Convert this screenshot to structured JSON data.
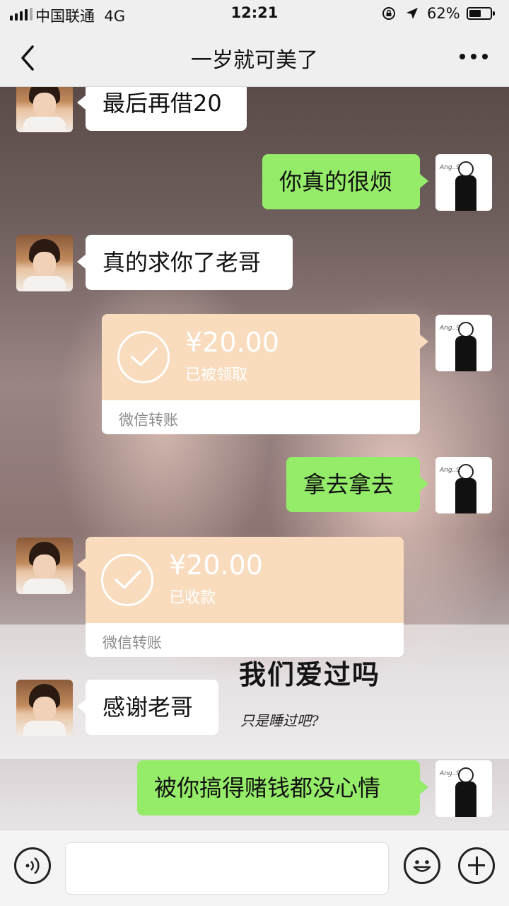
{
  "status_bar": {
    "carrier": "中国联通",
    "network": "4G",
    "time": "12:21",
    "battery": "62%",
    "battery_level": 0.62,
    "icons": [
      "signal-icon",
      "rotation-lock-icon",
      "location-icon",
      "battery-icon"
    ]
  },
  "nav": {
    "title": "一岁就可美了",
    "back_icon": "chevron-left-icon",
    "more_icon": "more-icon"
  },
  "background_text": {
    "line1": "我们爱过吗",
    "line2": "只是睡过吧?"
  },
  "messages": [
    {
      "side": "left",
      "type": "text",
      "text": "最后再借20"
    },
    {
      "side": "right",
      "type": "text",
      "text": "你真的很烦"
    },
    {
      "side": "left",
      "type": "text",
      "text": "真的求你了老哥"
    },
    {
      "side": "right",
      "type": "transfer",
      "amount": "¥20.00",
      "status": "已被领取",
      "label": "微信转账"
    },
    {
      "side": "right",
      "type": "text",
      "text": "拿去拿去"
    },
    {
      "side": "left",
      "type": "transfer",
      "amount": "¥20.00",
      "status": "已收款",
      "label": "微信转账"
    },
    {
      "side": "left",
      "type": "text",
      "text": "感谢老哥"
    },
    {
      "side": "right",
      "type": "text",
      "text": "被你搞得赌钱都没心情"
    }
  ],
  "input_bar": {
    "voice_icon": "voice-icon",
    "emoji_icon": "emoji-icon",
    "plus_icon": "plus-icon"
  },
  "colors": {
    "own_bubble": "#95ec69",
    "other_bubble": "#ffffff",
    "transfer_card": "#f8dcbd",
    "bar_bg": "#efefef"
  }
}
